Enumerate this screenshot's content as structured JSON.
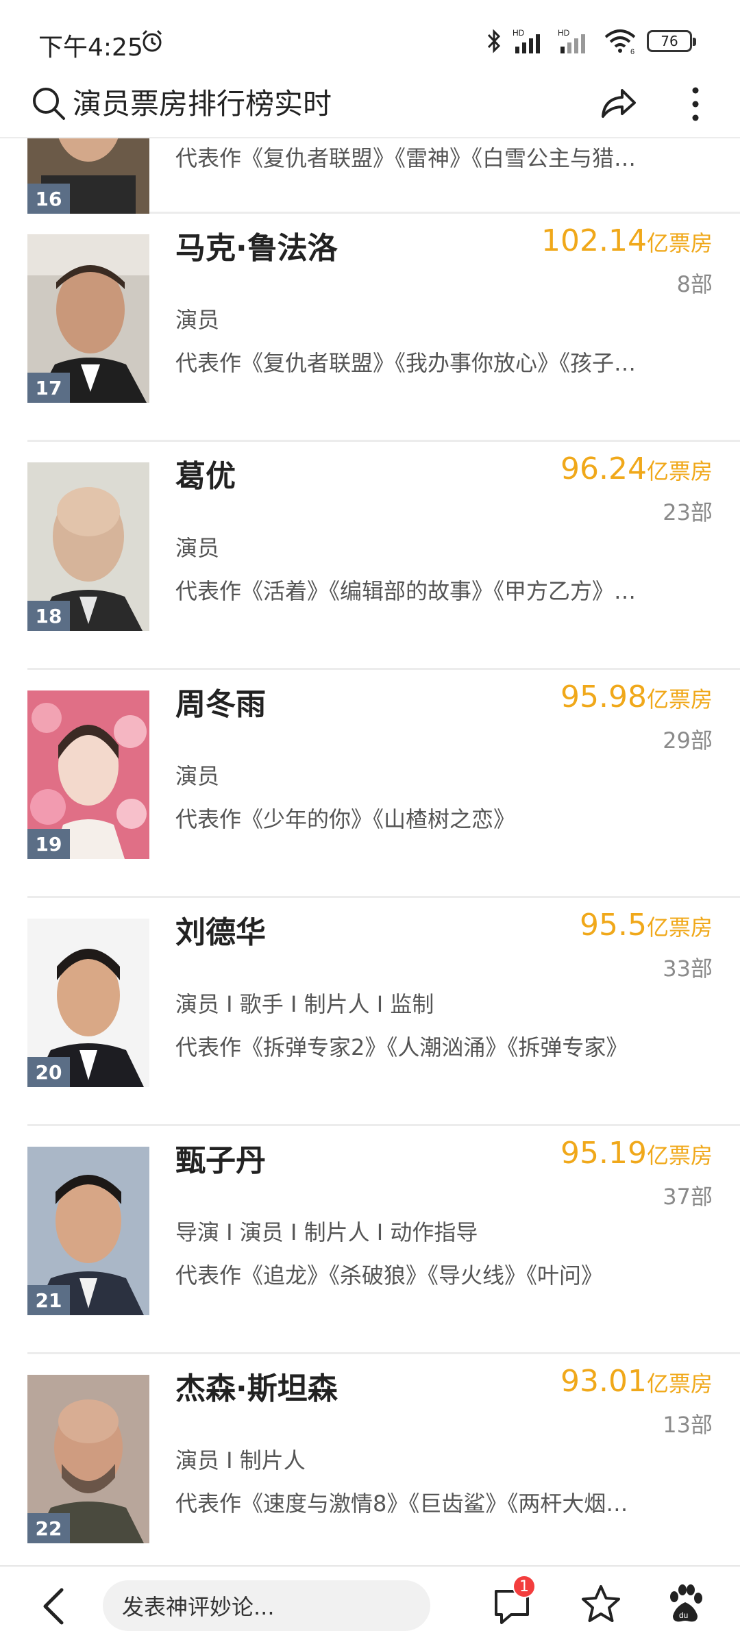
{
  "status": {
    "time": "下午4:25",
    "battery": "76",
    "signal_labels": [
      "HD",
      "HD"
    ],
    "wifi_sub": "6"
  },
  "header": {
    "query": "演员票房排行榜实时"
  },
  "list": [
    {
      "rank": "16",
      "name": "",
      "box_value": "",
      "box_unit": "",
      "films": "",
      "roles": "",
      "works": "代表作《复仇者联盟》《雷神》《白雪公主与猎…",
      "photo_bg": "#6b5a48"
    },
    {
      "rank": "17",
      "name": "马克·鲁法洛",
      "box_value": "102.14",
      "box_unit": "亿票房",
      "films": "8部",
      "roles": "演员",
      "works": "代表作《复仇者联盟》《我办事你放心》《孩子…",
      "photo_bg": "#c9c4bd"
    },
    {
      "rank": "18",
      "name": "葛优",
      "box_value": "96.24",
      "box_unit": "亿票房",
      "films": "23部",
      "roles": "演员",
      "works": "代表作《活着》《编辑部的故事》《甲方乙方》…",
      "photo_bg": "#d8d7cf"
    },
    {
      "rank": "19",
      "name": "周冬雨",
      "box_value": "95.98",
      "box_unit": "亿票房",
      "films": "29部",
      "roles": "演员",
      "works": "代表作《少年的你》《山楂树之恋》",
      "photo_bg": "#e36f86"
    },
    {
      "rank": "20",
      "name": "刘德华",
      "box_value": "95.5",
      "box_unit": "亿票房",
      "films": "33部",
      "roles": "演员 I 歌手 I 制片人 I 监制",
      "works": "代表作《拆弹专家2》《人潮汹涌》《拆弹专家》",
      "photo_bg": "#f2f2f2"
    },
    {
      "rank": "21",
      "name": "甄子丹",
      "box_value": "95.19",
      "box_unit": "亿票房",
      "films": "37部",
      "roles": "导演 I 演员 I 制片人 I 动作指导",
      "works": "代表作《追龙》《杀破狼》《导火线》《叶问》",
      "photo_bg": "#a9b6c6"
    },
    {
      "rank": "22",
      "name": "杰森·斯坦森",
      "box_value": "93.01",
      "box_unit": "亿票房",
      "films": "13部",
      "roles": "演员 I 制片人",
      "works": "代表作《速度与激情8》《巨齿鲨》《两杆大烟…",
      "photo_bg": "#b9a79c"
    }
  ],
  "bottom": {
    "comment_placeholder": "发表神评妙论...",
    "badge_count": "1"
  },
  "colors": {
    "accent": "#f0a81a",
    "rank_badge": "#5b6e86",
    "notify": "#f33d3d"
  }
}
